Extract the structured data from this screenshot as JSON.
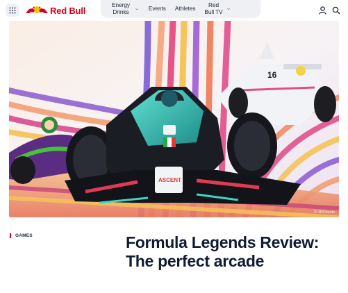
{
  "brand": {
    "name": "Red Bull",
    "accent_color": "#d6001c"
  },
  "header": {
    "menu_icon": "grid-icon",
    "nav": [
      {
        "label": "Energy Drinks",
        "has_dropdown": true
      },
      {
        "label": "Events",
        "has_dropdown": false
      },
      {
        "label": "Athletes",
        "has_dropdown": false
      },
      {
        "label": "Red Bull TV",
        "has_dropdown": true
      }
    ],
    "right_icons": [
      "user-icon",
      "search-icon"
    ]
  },
  "hero": {
    "credit": "© 3DClouds"
  },
  "article": {
    "category": "GAMES",
    "title": "Formula Legends Review: The perfect arcade"
  }
}
